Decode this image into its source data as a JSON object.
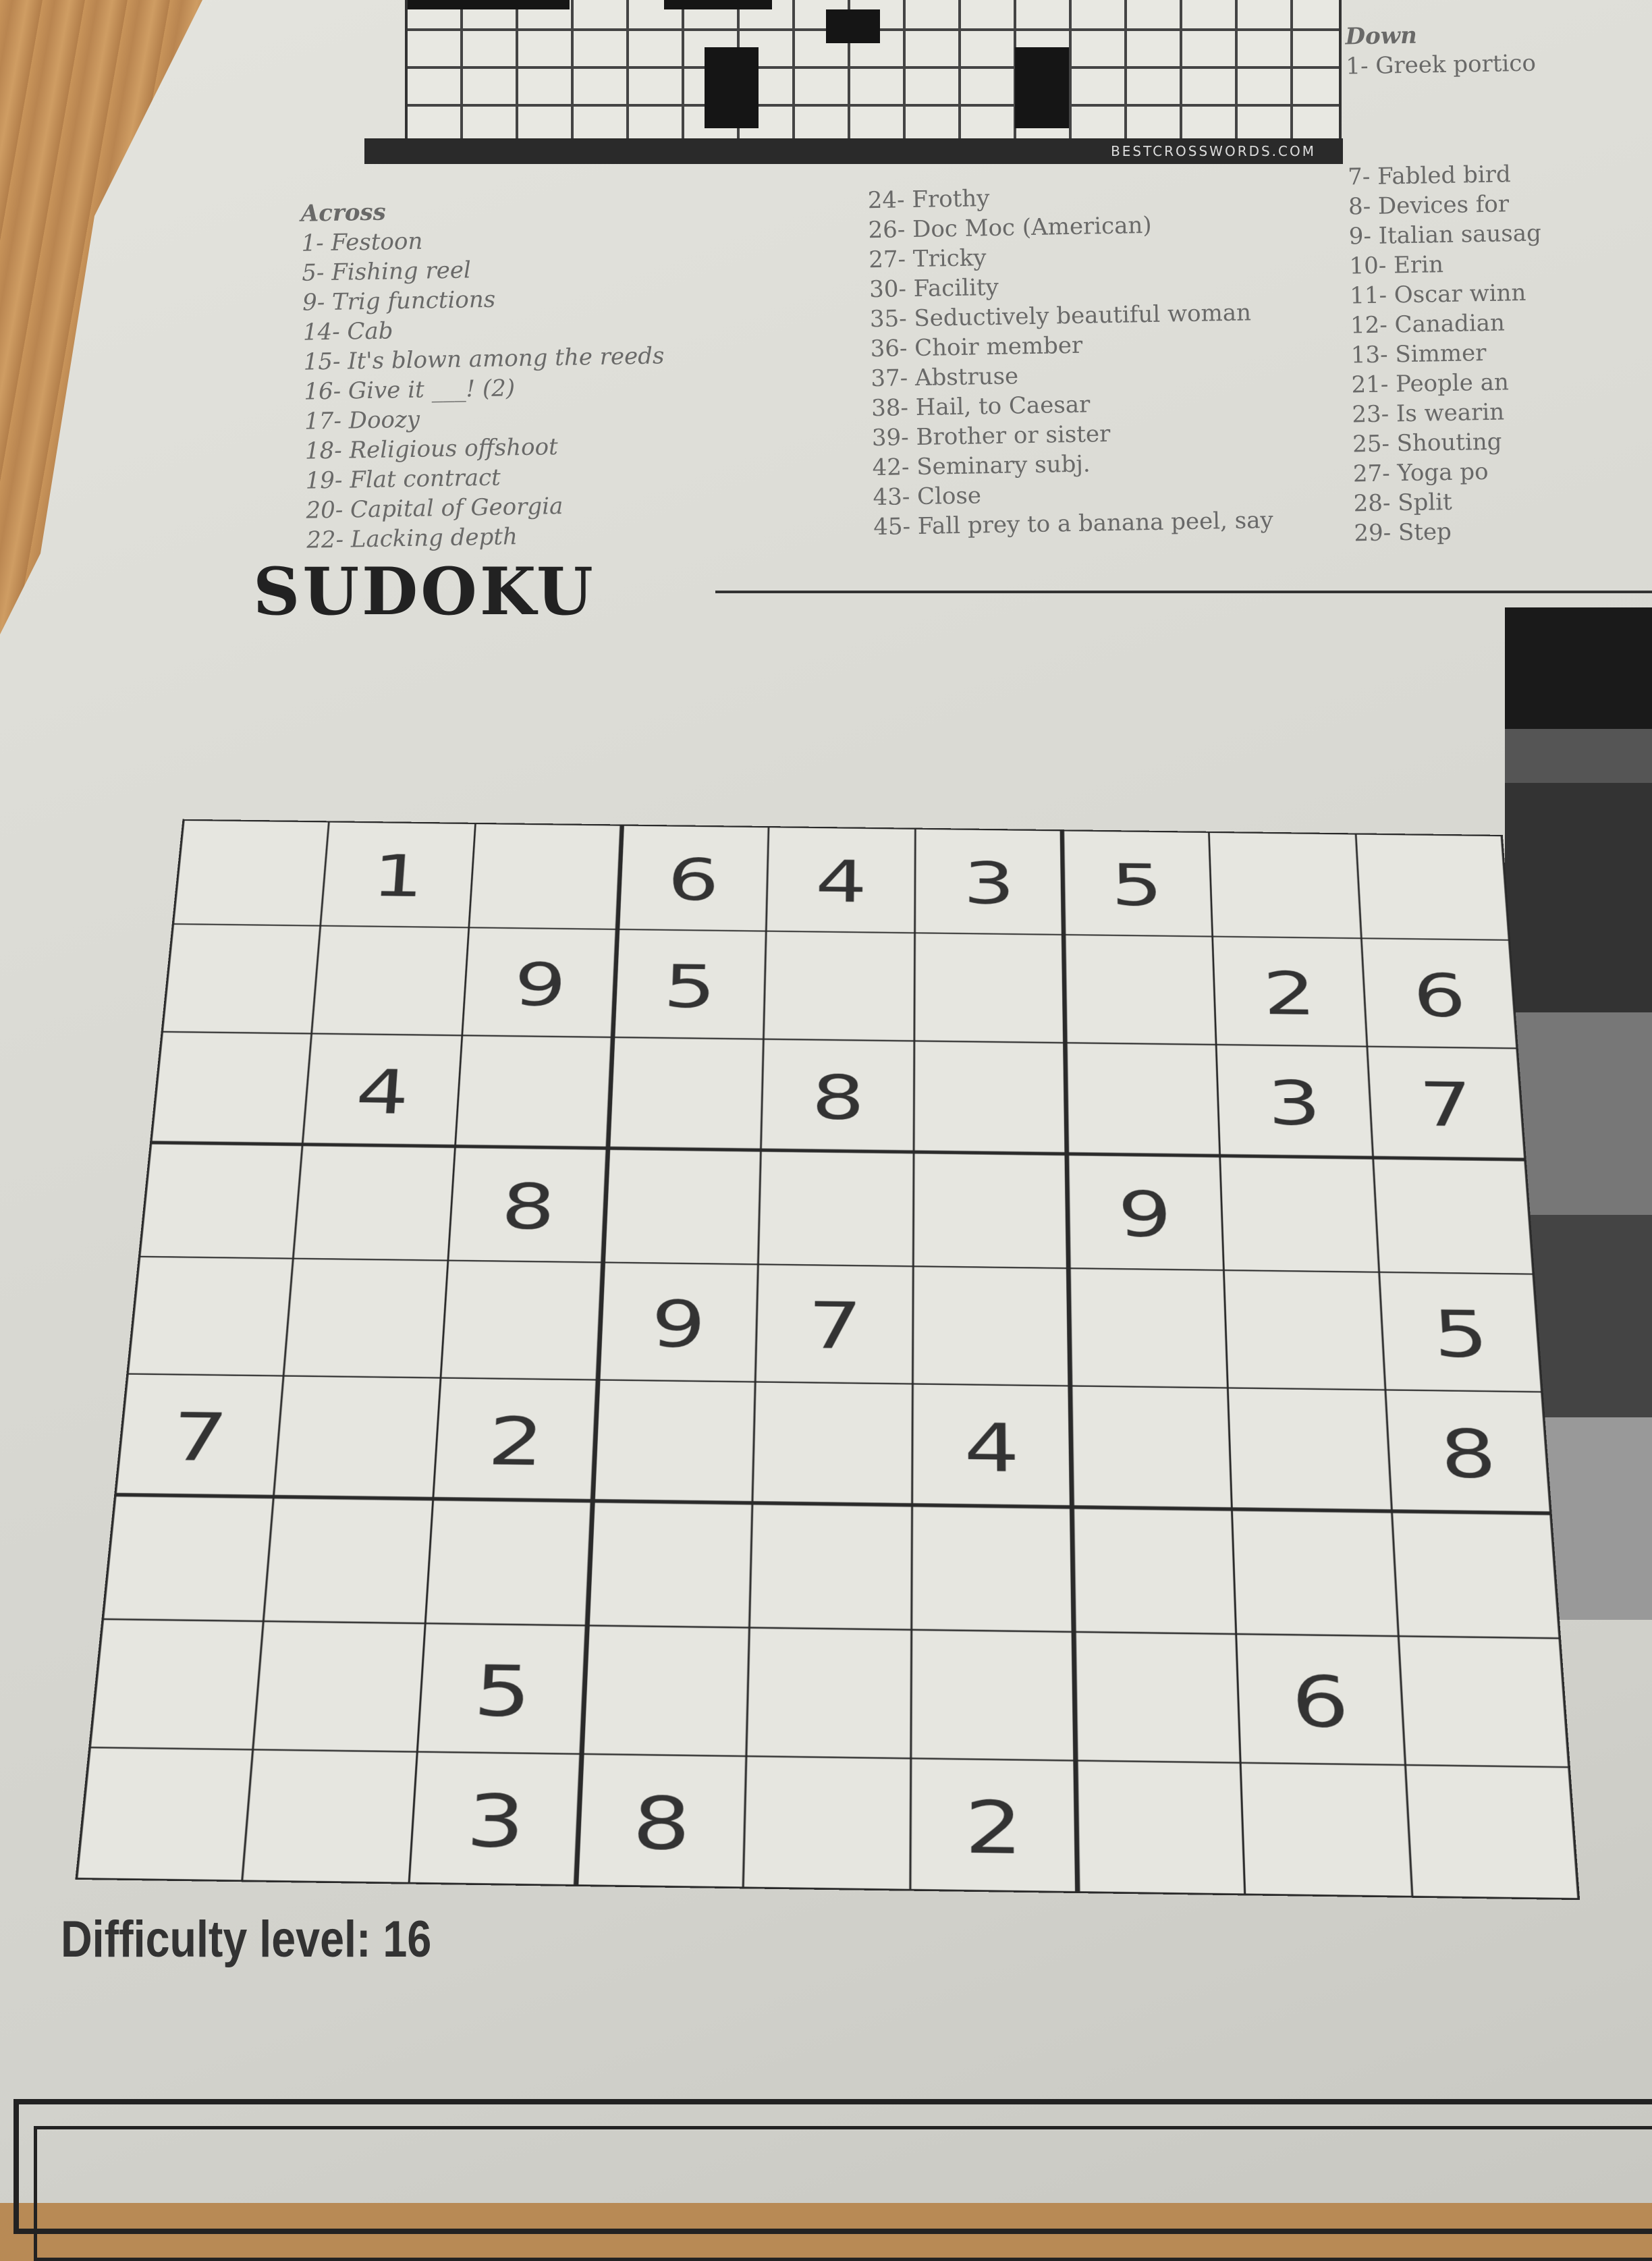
{
  "crossword": {
    "footer": "BESTCROSSWORDS.COM",
    "across": {
      "heading": "Across",
      "clues": [
        "1- Festoon",
        "5- Fishing reel",
        "9- Trig functions",
        "14- Cab",
        "15- It's blown among the reeds",
        "16- Give it ___! (2)",
        "17- Doozy",
        "18- Religious offshoot",
        "19- Flat contract",
        "20- Capital of Georgia",
        "22- Lacking depth"
      ]
    },
    "middle": {
      "clues": [
        "24- Frothy",
        "26- Doc Moc (American)",
        "27- Tricky",
        "30- Facility",
        "35- Seductively beautiful woman",
        "36- Choir member",
        "37- Abstruse",
        "38- Hail, to Caesar",
        "39- Brother or sister",
        "42- Seminary subj.",
        "43- Close",
        "45- Fall prey to a banana peel, say"
      ]
    },
    "down": {
      "heading": "Down",
      "clues": [
        "1- Greek portico",
        "7- Fabled bird",
        "8- Devices for",
        "9- Italian sausag",
        "10- Erin",
        "11- Oscar winn",
        "12- Canadian",
        "13- Simmer",
        "21- People an",
        "23- Is wearin",
        "25- Shouting",
        "27- Yoga po",
        "28- Split",
        "29- Step"
      ]
    }
  },
  "sudoku": {
    "title": "SUDOKU",
    "grid": [
      [
        "",
        "1",
        "",
        "6",
        "4",
        "3",
        "5",
        "",
        ""
      ],
      [
        "",
        "",
        "9",
        "5",
        "",
        "",
        "",
        "2",
        "6"
      ],
      [
        "",
        "4",
        "",
        "",
        "8",
        "",
        "",
        "3",
        "7"
      ],
      [
        "",
        "",
        "8",
        "",
        "",
        "",
        "9",
        "",
        ""
      ],
      [
        "",
        "",
        "",
        "9",
        "7",
        "",
        "",
        "",
        "5"
      ],
      [
        "7",
        "",
        "2",
        "",
        "",
        "4",
        "",
        "",
        "8"
      ],
      [
        "",
        "",
        "",
        "",
        "",
        "",
        "",
        "",
        ""
      ],
      [
        "",
        "",
        "5",
        "",
        "",
        "",
        "",
        "6",
        ""
      ],
      [
        "",
        "",
        "3",
        "8",
        "",
        "2",
        "",
        "",
        ""
      ]
    ],
    "difficulty": "Difficulty level: 16"
  }
}
